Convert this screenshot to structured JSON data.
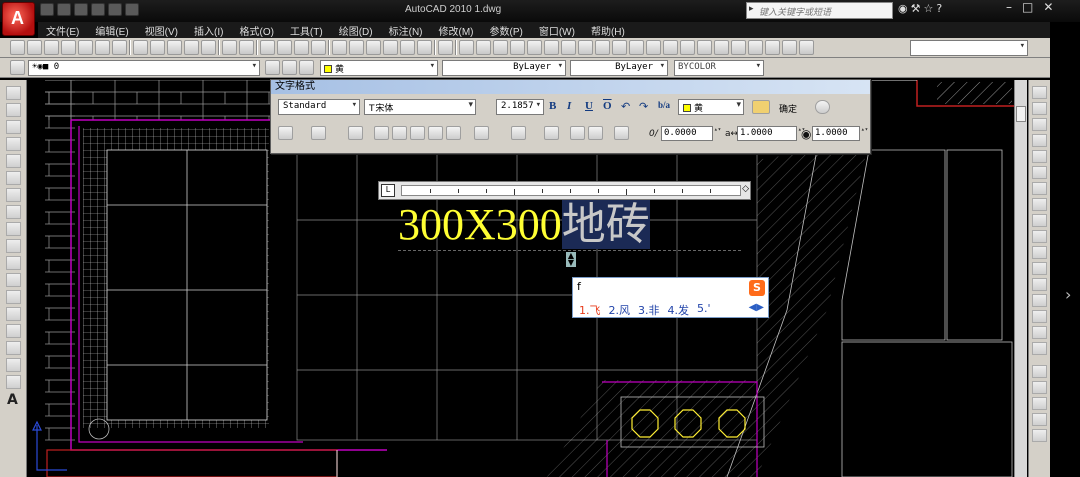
{
  "window": {
    "title": "AutoCAD 2010    1.dwg",
    "search_placeholder": "键入关键字或短语"
  },
  "menu": [
    "文件(E)",
    "编辑(E)",
    "视图(V)",
    "插入(I)",
    "格式(O)",
    "工具(T)",
    "绘图(D)",
    "标注(N)",
    "修改(M)",
    "参数(P)",
    "窗口(W)",
    "帮助(H)"
  ],
  "layer_bar": {
    "layer_value": "0",
    "color_value": "黄",
    "linetype_value": "ByLayer",
    "lineweight_value": "ByLayer",
    "plotstyle_value": "BYCOLOR"
  },
  "text_format": {
    "title": "文字格式",
    "style": "Standard",
    "font": "宋体",
    "height": "2.1857",
    "color": "黄",
    "ok_label": "确定",
    "oblique": "0.0000",
    "tracking": "1.0000",
    "width_factor": "1.0000"
  },
  "mtext": {
    "ascii_part": "300X300",
    "selected_part": "地砖"
  },
  "ime": {
    "input": "f",
    "logo": "S",
    "candidates": [
      "1.飞",
      "2.风",
      "3.非",
      "4.发",
      "5.'"
    ]
  },
  "colors": {
    "accent_yellow": "#ffff00",
    "drawing_magenta": "#c000c0",
    "drawing_red": "#c02020",
    "drawing_white": "#e0e0e0"
  }
}
